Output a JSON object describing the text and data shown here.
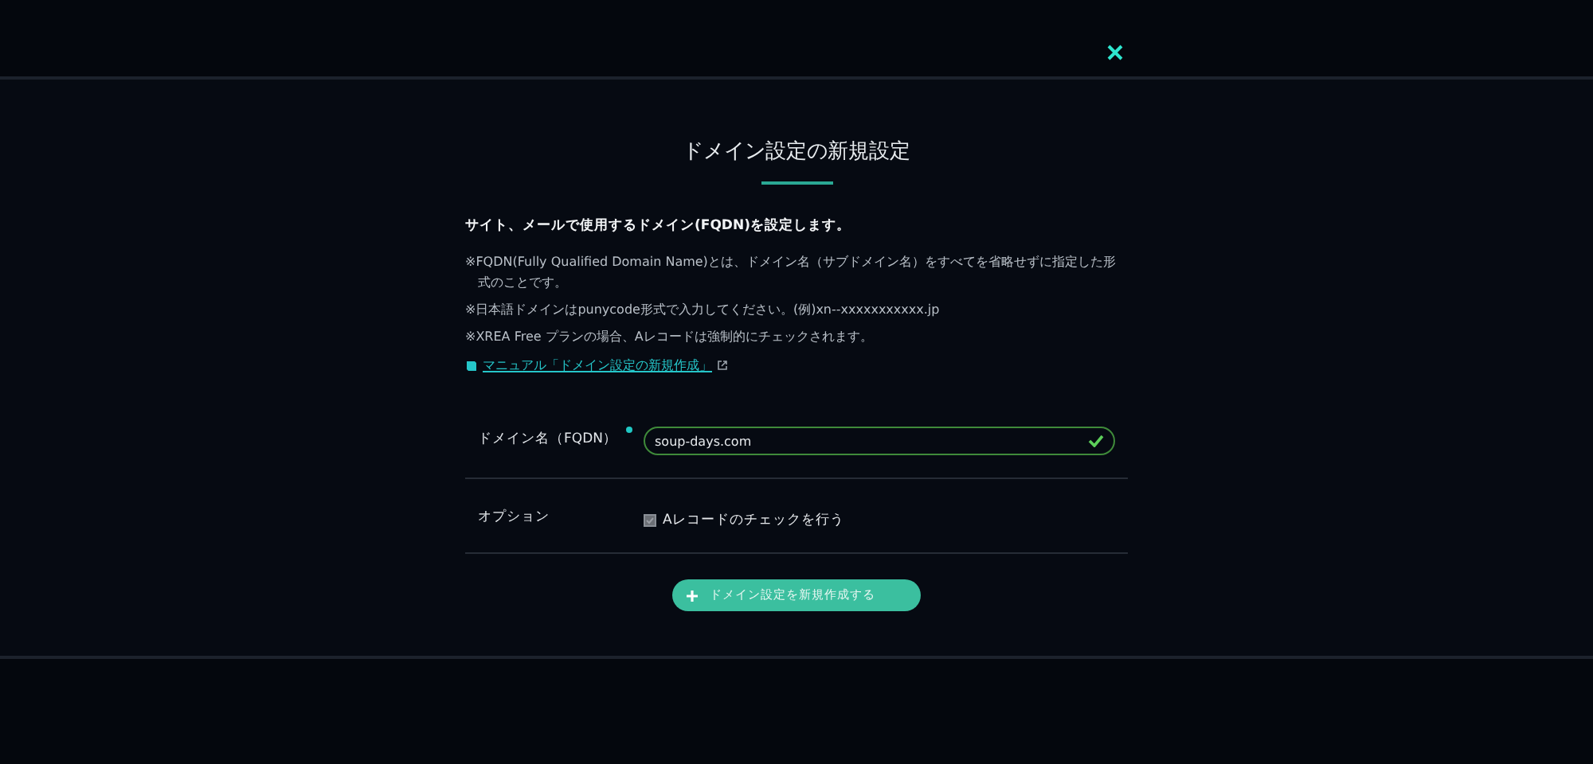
{
  "dialog": {
    "title": "ドメイン設定の新規設定",
    "intro": "サイト、メールで使用するドメイン(FQDN)を設定します。",
    "notes": [
      "※FQDN(Fully Qualified Domain Name)とは、ドメイン名（サブドメイン名）をすべてを省略せずに指定した形式のことです。",
      "※日本語ドメインはpunycode形式で入力してください。(例)xn--xxxxxxxxxxx.jp",
      "※XREA Free プランの場合、Aレコードは強制的にチェックされます。"
    ],
    "manual_link": "マニュアル「ドメイン設定の新規作成」",
    "fields": [
      {
        "kind": "text",
        "label": "ドメイン名（FQDN）",
        "required": true,
        "value": "soup-days.com",
        "valid": true
      },
      {
        "kind": "checkbox",
        "label": "オプション",
        "option": "Aレコードのチェックを行う",
        "checked": true,
        "disabled": true
      }
    ],
    "submit": "ドメイン設定を新規作成する"
  }
}
